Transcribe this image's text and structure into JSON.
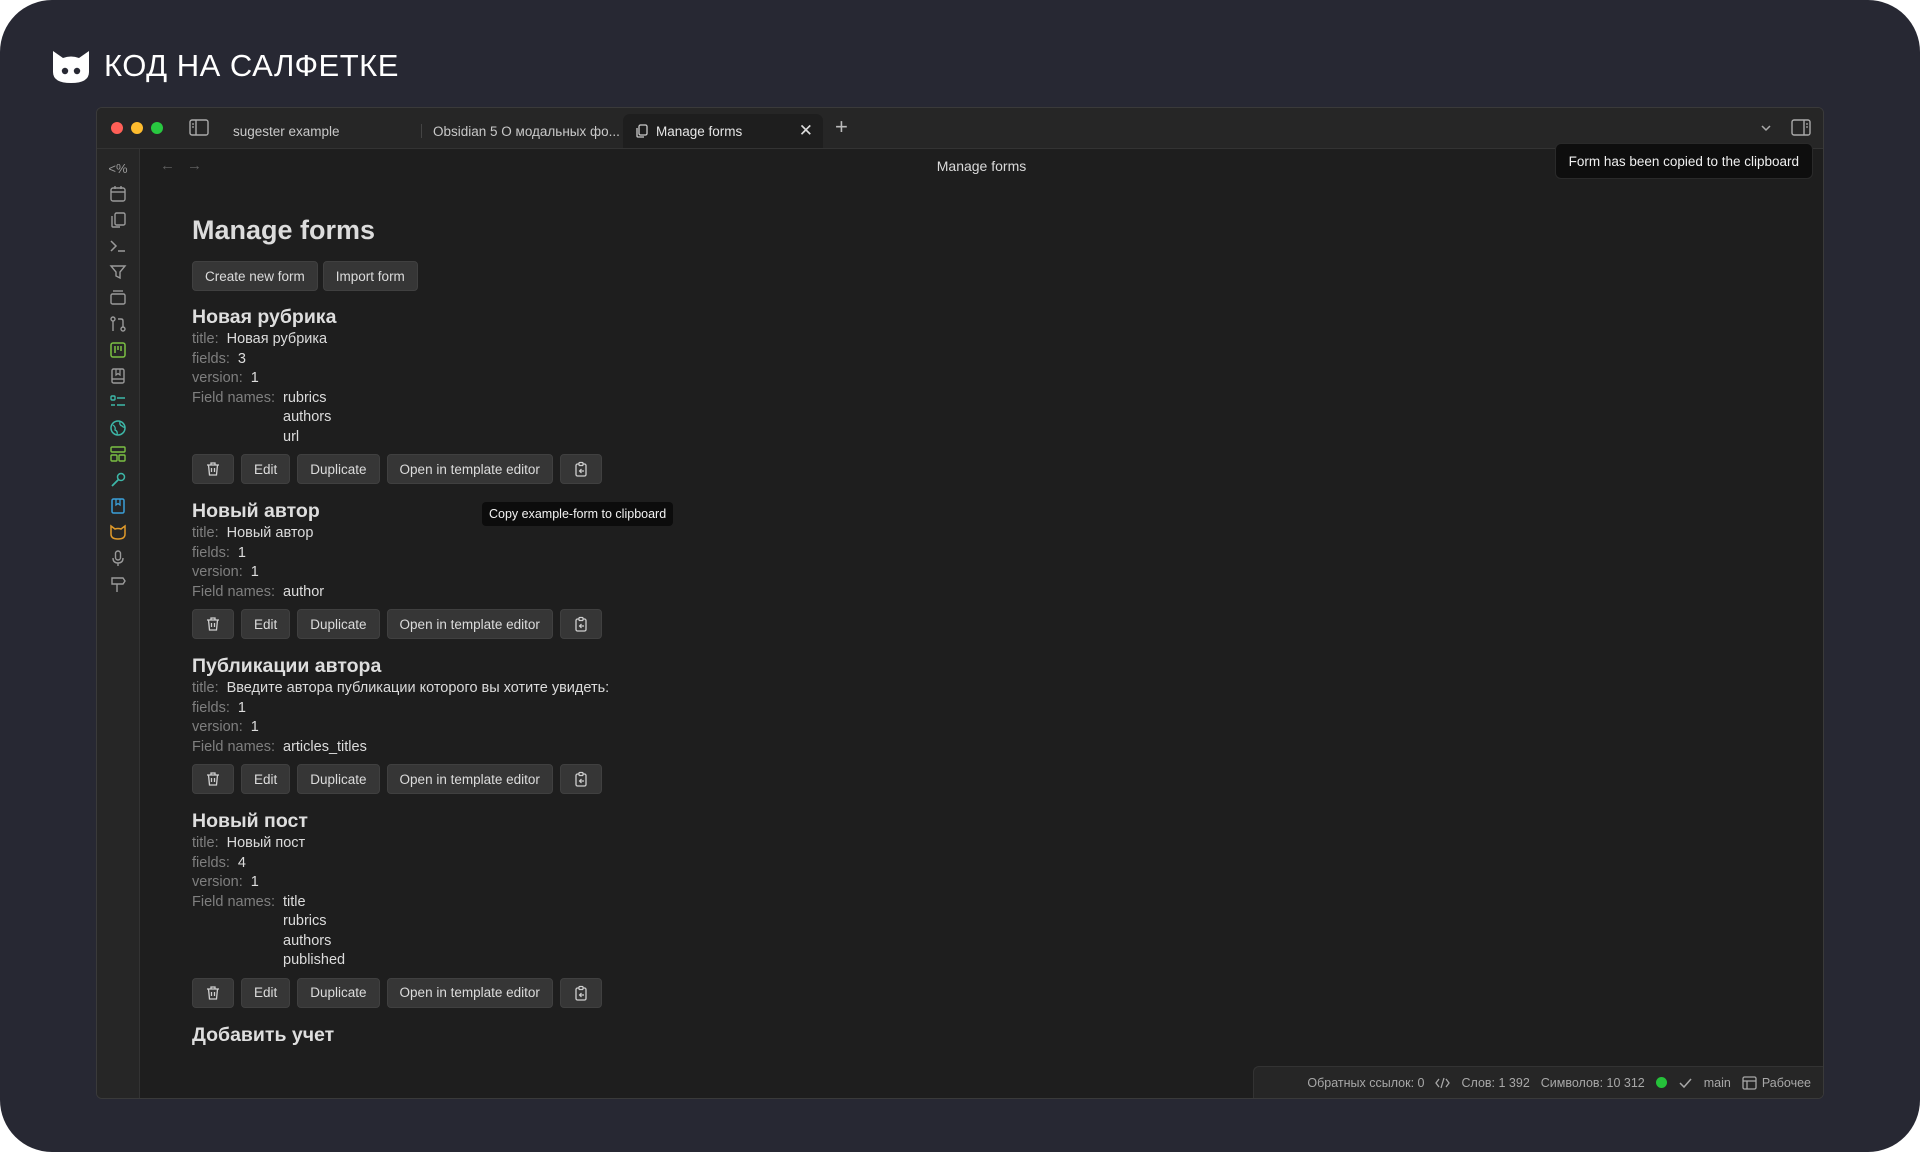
{
  "brand": {
    "text": "КОД НА САЛФЕТКЕ"
  },
  "tabs": [
    {
      "label": "sugester example"
    },
    {
      "label": "Obsidian 5 О модальных фо..."
    },
    {
      "label": "Manage forms"
    }
  ],
  "view": {
    "title": "Manage forms",
    "nav_back": "←",
    "nav_forward": "→"
  },
  "toast": {
    "text": "Form has been copied to the clipboard"
  },
  "ribbon": {
    "templater_label": "<%"
  },
  "page": {
    "title": "Manage forms",
    "create_label": "Create new form",
    "import_label": "Import form"
  },
  "labels": {
    "title": "title:",
    "fields": "fields:",
    "version": "version:",
    "field_names": "Field names:"
  },
  "buttons": {
    "edit": "Edit",
    "duplicate": "Duplicate",
    "template": "Open in template editor"
  },
  "forms": [
    {
      "name": "Новая рубрика",
      "title": "Новая рубрика",
      "fields": "3",
      "version": "1",
      "field_names": [
        "rubrics",
        "authors",
        "url"
      ]
    },
    {
      "name": "Новый автор",
      "title": "Новый автор",
      "fields": "1",
      "version": "1",
      "field_names": [
        "author"
      ]
    },
    {
      "name": "Публикации автора",
      "title": "Введите автора публикации которого вы хотите увидеть:",
      "fields": "1",
      "version": "1",
      "field_names": [
        "articles_titles"
      ]
    },
    {
      "name": "Новый пост",
      "title": "Новый пост",
      "fields": "4",
      "version": "1",
      "field_names": [
        "title",
        "rubrics",
        "authors",
        "published"
      ]
    },
    {
      "name": "Добавить учет"
    }
  ],
  "tooltip": {
    "text": "Copy example-form to clipboard"
  },
  "statusbar": {
    "backlinks": "Обратных ссылок: 0",
    "words": "Слов: 1 392",
    "chars": "Символов: 10 312",
    "branch": "main",
    "workspace": "Рабочее"
  },
  "colors": {
    "frame": "#272833",
    "window": "#1e1e1e",
    "sync_ok": "#25c13a"
  }
}
